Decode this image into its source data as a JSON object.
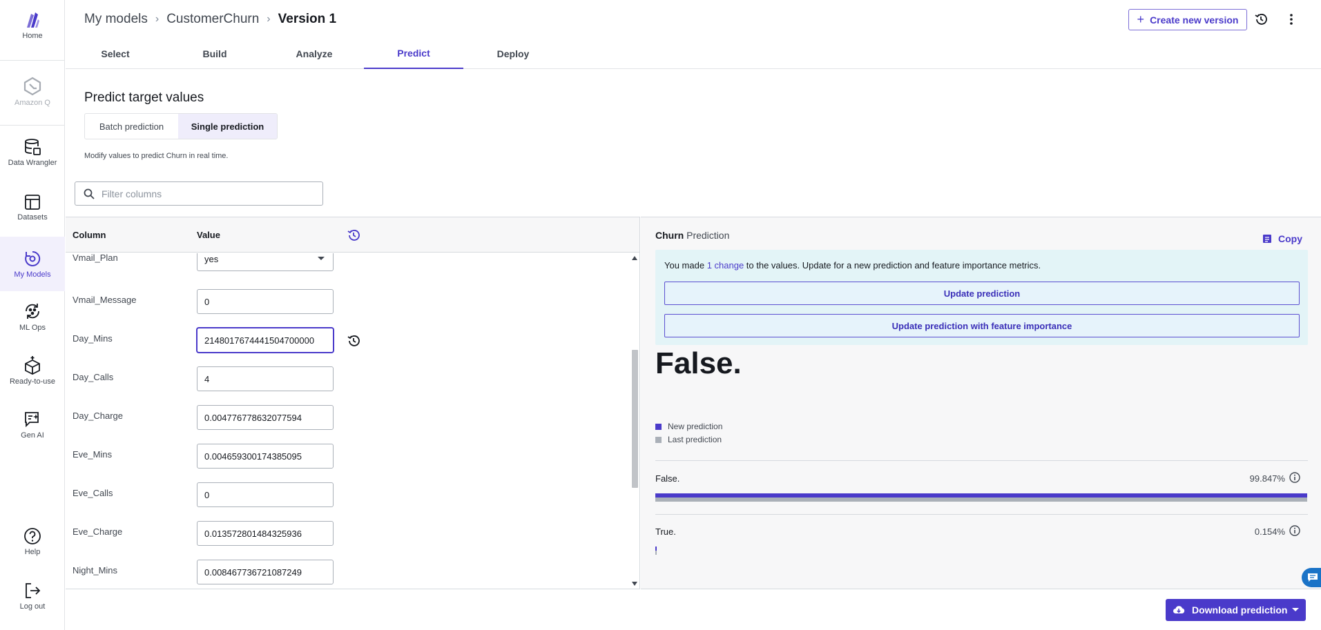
{
  "nav": {
    "home": "Home",
    "amazon_q": "Amazon Q",
    "data_wrangler": "Data Wrangler",
    "datasets": "Datasets",
    "my_models": "My Models",
    "ml_ops": "ML Ops",
    "ready_to_use": "Ready-to-use",
    "gen_ai": "Gen AI",
    "help": "Help",
    "log_out": "Log out"
  },
  "header": {
    "breadcrumb": [
      "My models",
      "CustomerChurn",
      "Version 1"
    ],
    "create_version": "Create new version"
  },
  "tabs": [
    "Select",
    "Build",
    "Analyze",
    "Predict",
    "Deploy"
  ],
  "predict": {
    "title": "Predict target values",
    "modes": [
      "Batch prediction",
      "Single prediction"
    ],
    "hint": "Modify values to predict Churn in real time.",
    "filter_placeholder": "Filter columns"
  },
  "table": {
    "headers": {
      "column": "Column",
      "value": "Value"
    },
    "rows": [
      {
        "name": "Vmail_Plan",
        "value": "yes"
      },
      {
        "name": "Vmail_Message",
        "value": "0"
      },
      {
        "name": "Day_Mins",
        "value": "2148017674441504700000"
      },
      {
        "name": "Day_Calls",
        "value": "4"
      },
      {
        "name": "Day_Charge",
        "value": "0.004776778632077594"
      },
      {
        "name": "Eve_Mins",
        "value": "0.004659300174385095"
      },
      {
        "name": "Eve_Calls",
        "value": "0"
      },
      {
        "name": "Eve_Charge",
        "value": "0.013572801484325936"
      },
      {
        "name": "Night_Mins",
        "value": "0.008467736721087249"
      }
    ]
  },
  "prediction": {
    "target": "Churn",
    "title_suffix": "Prediction",
    "copy": "Copy",
    "notice_pre": "You made ",
    "notice_link": "1 change",
    "notice_post": " to the values. Update for a new prediction and feature importance metrics.",
    "update_btn": "Update prediction",
    "update_fi_btn": "Update prediction with feature importance",
    "result": "False.",
    "legend_new": "New prediction",
    "legend_last": "Last prediction",
    "classes": [
      {
        "label": "False.",
        "pct": "99.847%",
        "value": 0.99847
      },
      {
        "label": "True.",
        "pct": "0.154%",
        "value": 0.00154
      }
    ]
  },
  "footer": {
    "download": "Download prediction"
  },
  "colors": {
    "accent": "#4a3aca",
    "last_prediction": "#aab0b8",
    "notice_bg": "#e3f4f7"
  }
}
